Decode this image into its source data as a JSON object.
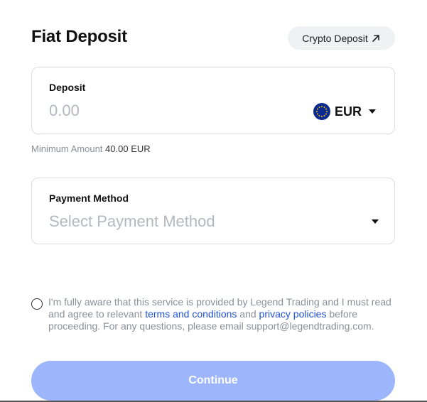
{
  "header": {
    "title": "Fiat Deposit",
    "crypto_deposit_label": "Crypto Deposit"
  },
  "deposit": {
    "label": "Deposit",
    "amount_value": "",
    "amount_placeholder": "0.00",
    "currency": "EUR",
    "currency_icon": "eu-flag-icon"
  },
  "minimum": {
    "label": "Minimum Amount",
    "value": "40.00 EUR"
  },
  "payment": {
    "label": "Payment Method",
    "placeholder": "Select Payment Method"
  },
  "consent": {
    "text_before": "I'm fully aware that this service is provided by Legend Trading and I must read and agree to relevant",
    "terms_link": "terms and conditions",
    "and_text": "and",
    "privacy_link": "privacy policies",
    "text_after": "before proceeding. For any questions, please email support@legendtrading.com."
  },
  "actions": {
    "continue_label": "Continue"
  },
  "colors": {
    "accent": "#1f52d6",
    "button_disabled": "#9db6fb",
    "flag_blue": "#0b2a8f",
    "flag_star": "#f2c200"
  }
}
